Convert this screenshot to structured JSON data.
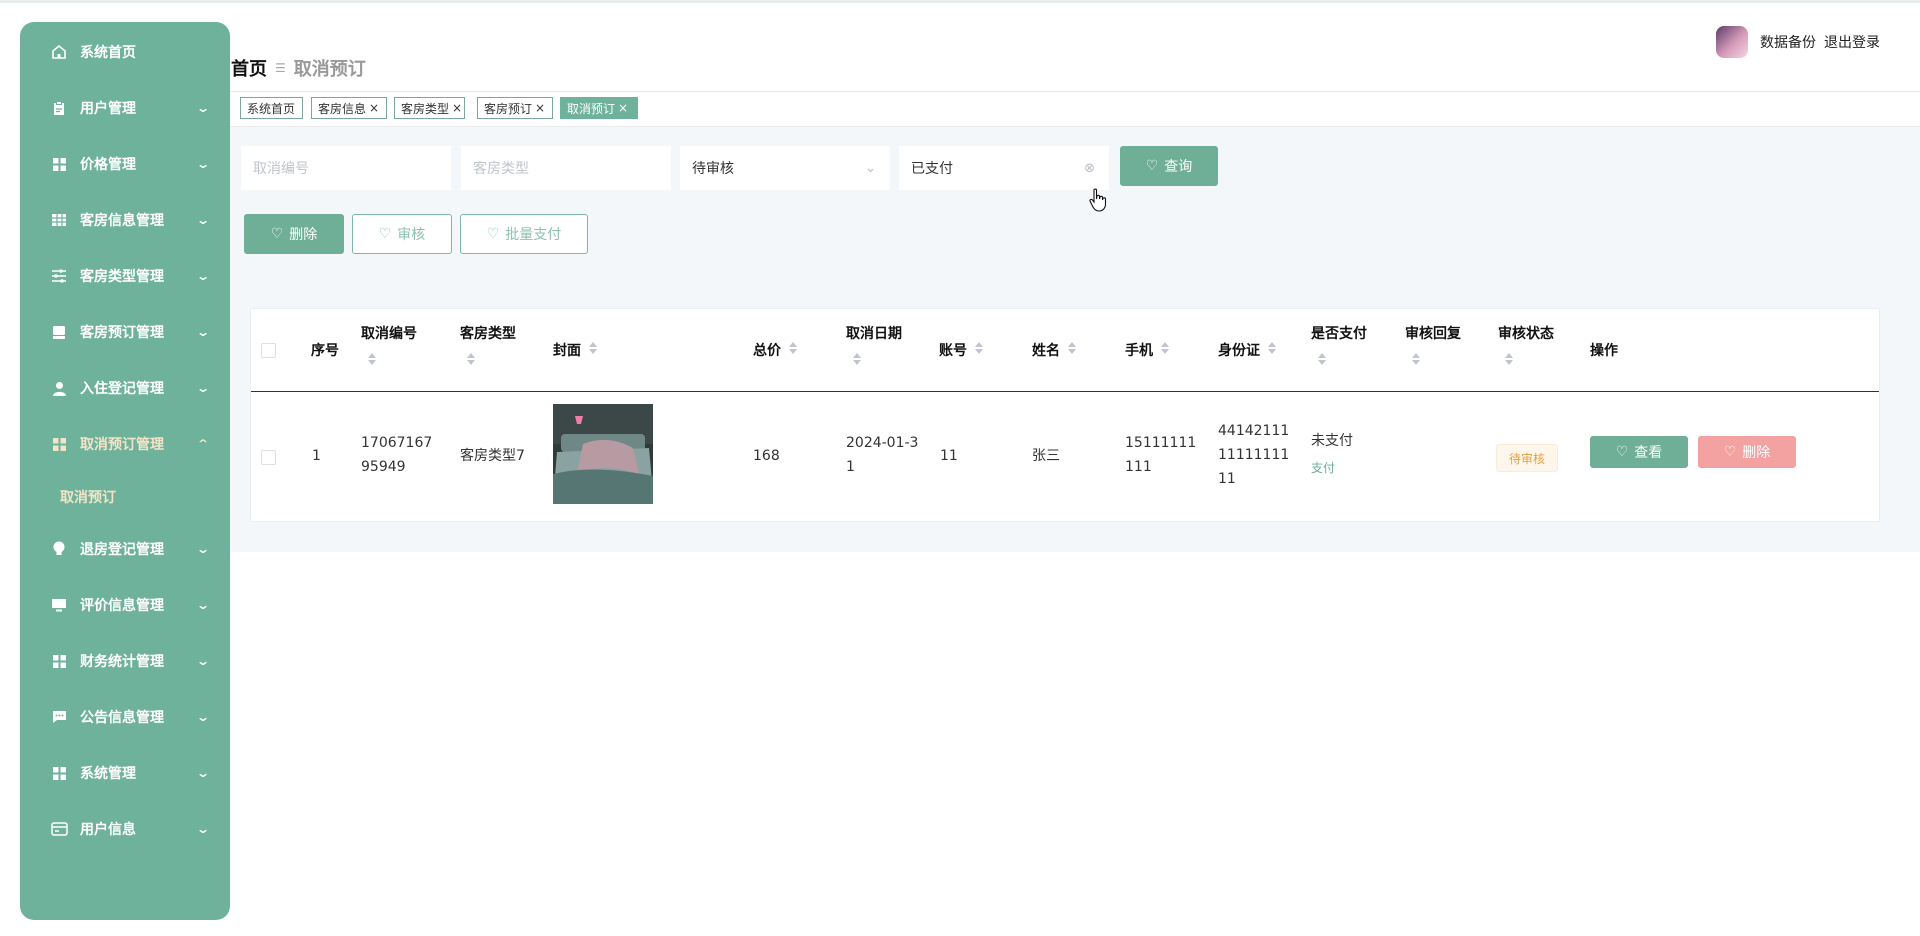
{
  "sidebar": {
    "items": [
      {
        "label": "系统首页",
        "icon": "home-icon",
        "has_arrow": false
      },
      {
        "label": "用户管理",
        "icon": "clipboard-icon",
        "has_arrow": true
      },
      {
        "label": "价格管理",
        "icon": "grid-icon",
        "has_arrow": true
      },
      {
        "label": "客房信息管理",
        "icon": "table-icon",
        "has_arrow": true
      },
      {
        "label": "客房类型管理",
        "icon": "sliders-icon",
        "has_arrow": true
      },
      {
        "label": "客房预订管理",
        "icon": "bed-icon",
        "has_arrow": true
      },
      {
        "label": "入住登记管理",
        "icon": "user-icon",
        "has_arrow": true
      },
      {
        "label": "取消预订管理",
        "icon": "grid-icon",
        "has_arrow": true,
        "expanded": true
      },
      {
        "label": "退房登记管理",
        "icon": "bulb-icon",
        "has_arrow": true
      },
      {
        "label": "评价信息管理",
        "icon": "monitor-icon",
        "has_arrow": true
      },
      {
        "label": "财务统计管理",
        "icon": "grid-icon",
        "has_arrow": true
      },
      {
        "label": "公告信息管理",
        "icon": "chat-icon",
        "has_arrow": true
      },
      {
        "label": "系统管理",
        "icon": "grid-icon",
        "has_arrow": true
      },
      {
        "label": "用户信息",
        "icon": "card-icon",
        "has_arrow": true
      }
    ],
    "sub_item": "取消预订"
  },
  "header": {
    "breadcrumb_home": "首页",
    "breadcrumb_current": "取消预订",
    "backup_label": "数据备份",
    "logout_label": "退出登录"
  },
  "tabs": [
    {
      "label": "系统首页",
      "closable": false
    },
    {
      "label": "客房信息",
      "closable": true
    },
    {
      "label": "客房类型",
      "closable": true
    },
    {
      "label": "客房预订",
      "closable": true
    },
    {
      "label": "取消预订",
      "closable": true,
      "active": true
    }
  ],
  "search": {
    "cancel_no_placeholder": "取消编号",
    "room_type_placeholder": "客房类型",
    "review_status_value": "待审核",
    "payment_value": "已支付",
    "query_label": "查询"
  },
  "actions": {
    "delete_label": "删除",
    "review_label": "审核",
    "batch_pay_label": "批量支付"
  },
  "table": {
    "columns": [
      "序号",
      "取消编号",
      "客房类型",
      "封面",
      "总价",
      "取消日期",
      "账号",
      "姓名",
      "手机",
      "身份证",
      "是否支付",
      "审核回复",
      "审核状态",
      "操作"
    ],
    "rows": [
      {
        "index": "1",
        "cancel_no": "1706716795949",
        "room_type": "客房类型7",
        "total": "168",
        "cancel_date": "2024-01-31",
        "account": "11",
        "name": "张三",
        "phone": "15111111111",
        "id_card": "441421111111111111",
        "paid": "未支付",
        "pay_link": "支付",
        "review_reply": "",
        "review_status": "待审核",
        "view_label": "查看",
        "delete_label": "删除"
      }
    ]
  },
  "colors": {
    "sidebar": "#6fb29b",
    "primary": "#6fae97",
    "danger": "#f3a1a1",
    "warning": "#e6a23c"
  }
}
